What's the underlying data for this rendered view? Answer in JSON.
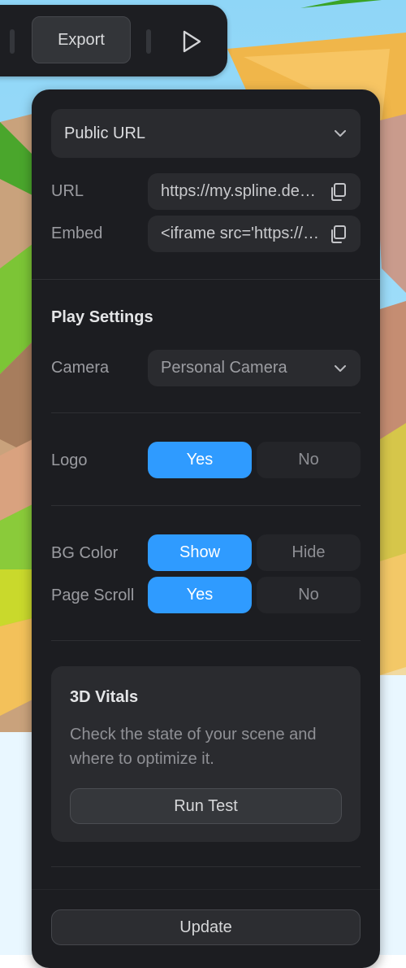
{
  "toolbar": {
    "export_label": "Export",
    "play_icon": "play-icon"
  },
  "share": {
    "visibility_selected": "Public URL",
    "url_label": "URL",
    "url_value": "https://my.spline.design/",
    "embed_label": "Embed",
    "embed_value": "<iframe src='https://my.spline.design/"
  },
  "play_settings": {
    "heading": "Play Settings",
    "camera_label": "Camera",
    "camera_selected": "Personal Camera"
  },
  "logo": {
    "label": "Logo",
    "yes": "Yes",
    "no": "No",
    "selected": "Yes"
  },
  "bg_color": {
    "label": "BG Color",
    "show": "Show",
    "hide": "Hide",
    "selected": "Show"
  },
  "page_scroll": {
    "label": "Page Scroll",
    "yes": "Yes",
    "no": "No",
    "selected": "Yes"
  },
  "vitals": {
    "title": "3D Vitals",
    "description_line1": "Check the state of your scene and",
    "description_line2": "where to optimize it.",
    "run_label": "Run Test"
  },
  "footer": {
    "update_label": "Update"
  },
  "colors": {
    "accent": "#2f9bff",
    "panel": "#1c1d21",
    "control": "#2a2b2f"
  }
}
